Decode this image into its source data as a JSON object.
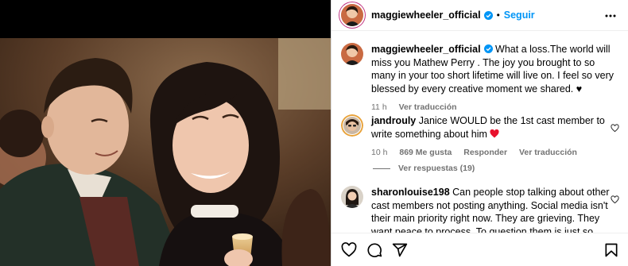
{
  "post": {
    "username": "maggiewheeler_official",
    "separator": "•",
    "follow_label": "Seguir"
  },
  "caption": {
    "username": "maggiewheeler_official",
    "text": "What a loss.The world will miss you Mathew Perry . The joy you brought to so many in your too short lifetime will live on. I feel so very blessed by every creative moment we shared. ♥",
    "time": "11 h",
    "translate": "Ver traducción"
  },
  "comments": [
    {
      "username": "jandrouly",
      "text": "Janice WOULD be the 1st cast member to write something about him",
      "time": "10 h",
      "likes": "869 Me gusta",
      "reply": "Responder",
      "translate": "Ver traducción",
      "view_replies": "Ver respuestas (19)"
    },
    {
      "username": "sharonlouise198",
      "text": "Can people stop talking about other cast members not posting anything. Social media isn't their main priority right now. They are grieving. They want peace to process. To question them is just so strange. I mean, most"
    }
  ],
  "colors": {
    "accent": "#0095f6",
    "verified": "#0095f6",
    "heart": "#ff3040",
    "muted": "#737373"
  },
  "icons": [
    "more-options-icon",
    "verified-badge-icon",
    "heart-icon",
    "comment-icon",
    "share-icon",
    "bookmark-icon"
  ]
}
